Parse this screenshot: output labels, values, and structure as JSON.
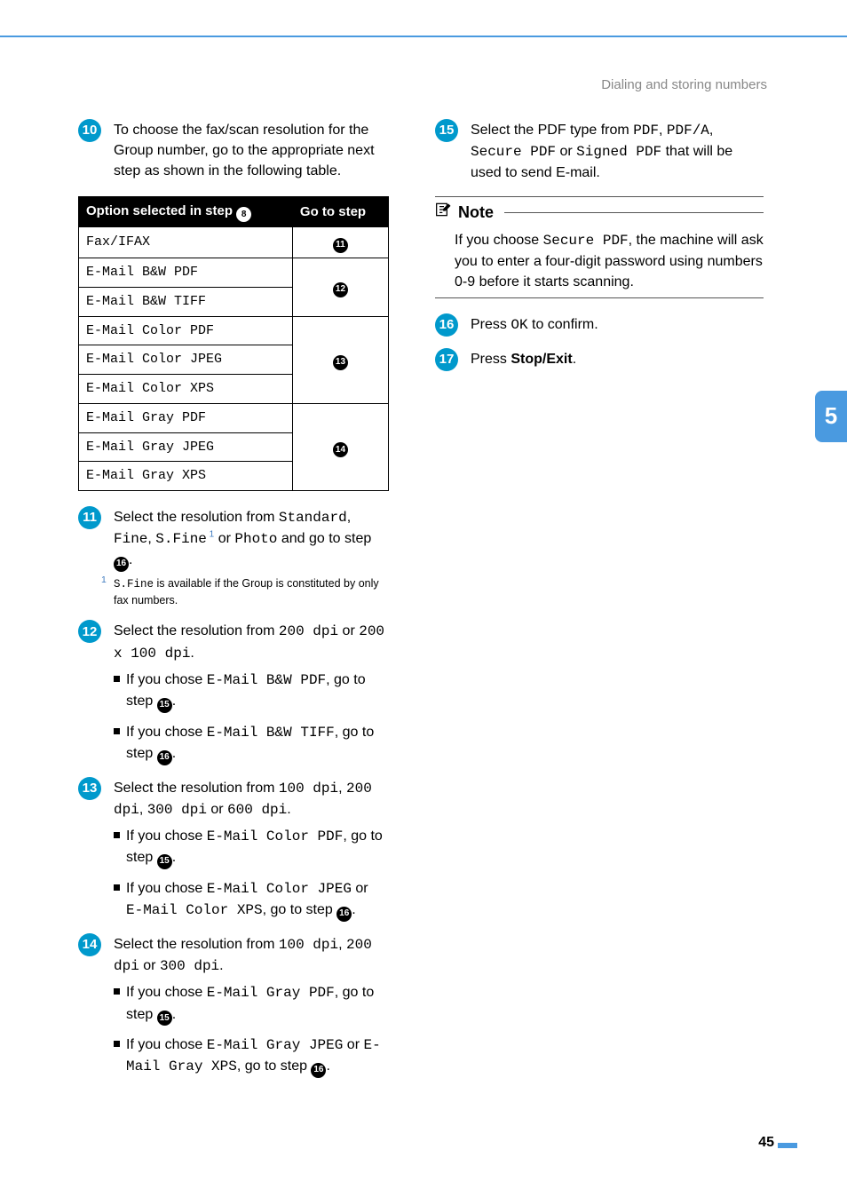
{
  "header": "Dialing and storing numbers",
  "side_tab": "5",
  "page_number": "45",
  "table": {
    "col1_header_pre": "Option selected in step ",
    "col1_header_ref": "8",
    "col2_header": "Go to step",
    "rows": {
      "r1": "Fax/IFAX",
      "r2": "E-Mail B&W PDF",
      "r3": "E-Mail B&W TIFF",
      "r4": "E-Mail Color PDF",
      "r5": "E-Mail Color JPEG",
      "r6": "E-Mail Color XPS",
      "r7": "E-Mail Gray PDF",
      "r8": "E-Mail Gray JPEG",
      "r9": "E-Mail Gray XPS"
    },
    "refs": {
      "g1": "11",
      "g2": "12",
      "g3": "13",
      "g4": "14"
    }
  },
  "steps": {
    "s10": {
      "num": "10",
      "text": "To choose the fax/scan resolution for the Group number, go to the appropriate next step as shown in the following table."
    },
    "s11": {
      "num": "11",
      "pre": "Select the resolution from ",
      "opt1": "Standard",
      "sep1": ", ",
      "opt2": "Fine",
      "sep2": ", ",
      "opt3": "S.Fine",
      "sup": " 1",
      "mid": " or ",
      "opt4": "Photo",
      "post": " and go to step ",
      "ref": "16",
      "dot": ".",
      "fn_num": "1",
      "fn_mono": "S.Fine",
      "fn_rest": " is available if the Group is constituted by only fax numbers."
    },
    "s12": {
      "num": "12",
      "pre": "Select the resolution from ",
      "opt1": "200 dpi",
      "mid": " or ",
      "opt2": "200 x 100 dpi",
      "dot": ".",
      "b1_pre": "If you chose ",
      "b1_mono": "E-Mail B&W PDF",
      "b1_mid": ", go to step ",
      "b1_ref": "15",
      "b1_dot": ".",
      "b2_pre": "If you chose ",
      "b2_mono": "E-Mail B&W TIFF",
      "b2_mid": ", go to step ",
      "b2_ref": "16",
      "b2_dot": "."
    },
    "s13": {
      "num": "13",
      "pre": "Select the resolution from ",
      "o1": "100 dpi",
      "c1": ", ",
      "o2": "200 dpi",
      "c2": ", ",
      "o3": "300 dpi",
      "or": " or ",
      "o4": "600 dpi",
      "dot": ".",
      "b1_pre": "If you chose ",
      "b1_mono": "E-Mail Color PDF",
      "b1_mid": ", go to step ",
      "b1_ref": "15",
      "b1_dot": ".",
      "b2_pre": "If you chose ",
      "b2_m1": "E-Mail Color JPEG",
      "b2_or": " or ",
      "b2_m2": "E-Mail Color XPS",
      "b2_mid": ", go to step ",
      "b2_ref": "16",
      "b2_dot": "."
    },
    "s14": {
      "num": "14",
      "pre": "Select the resolution from ",
      "o1": "100 dpi",
      "c1": ", ",
      "o2": "200 dpi",
      "or": " or ",
      "o3": "300 dpi",
      "dot": ".",
      "b1_pre": "If you chose ",
      "b1_mono": "E-Mail Gray PDF",
      "b1_mid": ", go to step ",
      "b1_ref": "15",
      "b1_dot": ".",
      "b2_pre": "If you chose ",
      "b2_m1": "E-Mail Gray JPEG",
      "b2_or": " or ",
      "b2_m2": "E-Mail Gray XPS",
      "b2_mid": ", go to step ",
      "b2_ref": "16",
      "b2_dot": "."
    },
    "s15": {
      "num": "15",
      "pre": "Select the PDF type from ",
      "o1": "PDF",
      "c1": ", ",
      "o2": "PDF/A",
      "c2": ", ",
      "o3": "Secure PDF",
      "or": " or ",
      "o4": "Signed PDF",
      "post": " that will be used to send E-mail."
    },
    "s16": {
      "num": "16",
      "pre": "Press ",
      "mono": "OK",
      "post": " to confirm."
    },
    "s17": {
      "num": "17",
      "pre": "Press ",
      "bold": "Stop/Exit",
      "post": "."
    }
  },
  "note": {
    "title": "Note",
    "pre": "If you choose ",
    "mono": "Secure PDF",
    "post": ", the machine will ask you to enter a four-digit password using numbers 0-9 before it starts scanning."
  }
}
